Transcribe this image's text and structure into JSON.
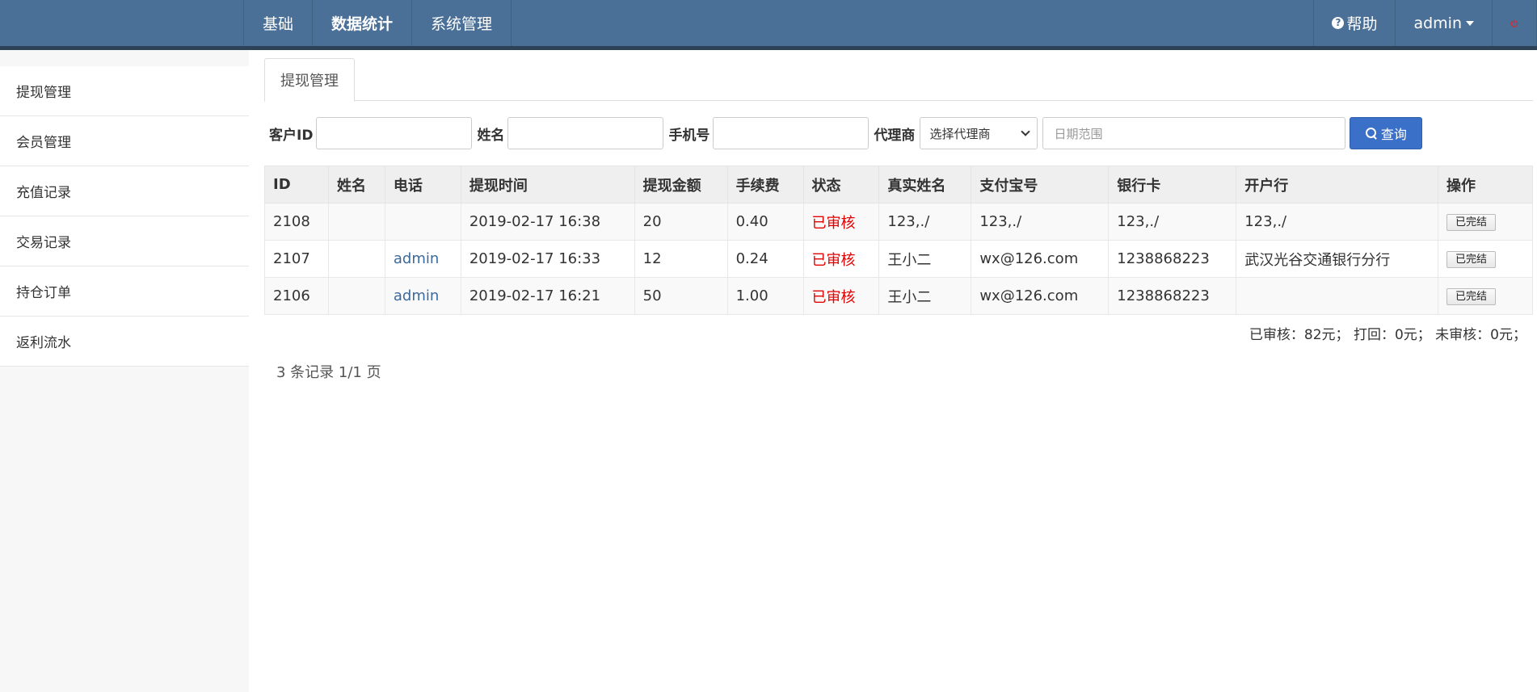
{
  "topnav": {
    "items": [
      "基础",
      "数据统计",
      "系统管理"
    ],
    "active": "数据统计",
    "help_label": "帮助",
    "user_label": "admin"
  },
  "sidebar": {
    "items": [
      "提现管理",
      "会员管理",
      "充值记录",
      "交易记录",
      "持仓订单",
      "返利流水"
    ]
  },
  "tab": {
    "label": "提现管理"
  },
  "filters": {
    "customer_id_label": "客户ID",
    "name_label": "姓名",
    "phone_label": "手机号",
    "agent_label": "代理商",
    "agent_select_value": "选择代理商",
    "date_placeholder": "日期范围",
    "query_button": "查询"
  },
  "table": {
    "headers": [
      "ID",
      "姓名",
      "电话",
      "提现时间",
      "提现金额",
      "手续费",
      "状态",
      "真实姓名",
      "支付宝号",
      "银行卡",
      "开户行",
      "操作"
    ],
    "rows": [
      [
        "2108",
        "",
        "",
        "2019-02-17 16:38",
        "20",
        "0.40",
        "已审核",
        "123,./",
        "123,./",
        "123,./",
        "123,./",
        "已完结"
      ],
      [
        "2107",
        "",
        "admin",
        "2019-02-17 16:33",
        "12",
        "0.24",
        "已审核",
        "王小二",
        "wx@126.com",
        "1238868223",
        "武汉光谷交通银行分行",
        "已完结"
      ],
      [
        "2106",
        "",
        "admin",
        "2019-02-17 16:21",
        "50",
        "1.00",
        "已审核",
        "王小二",
        "wx@126.com",
        "1238868223",
        "",
        "已完结"
      ]
    ]
  },
  "summary": "已审核：82元；  打回：0元；  未审核：0元；",
  "pager": "3 条记录 1/1 页",
  "colors": {
    "topbar": "#4a7098",
    "status": "#e00000",
    "query_button": "#3a70c8",
    "power_icon": "#d9262c"
  }
}
